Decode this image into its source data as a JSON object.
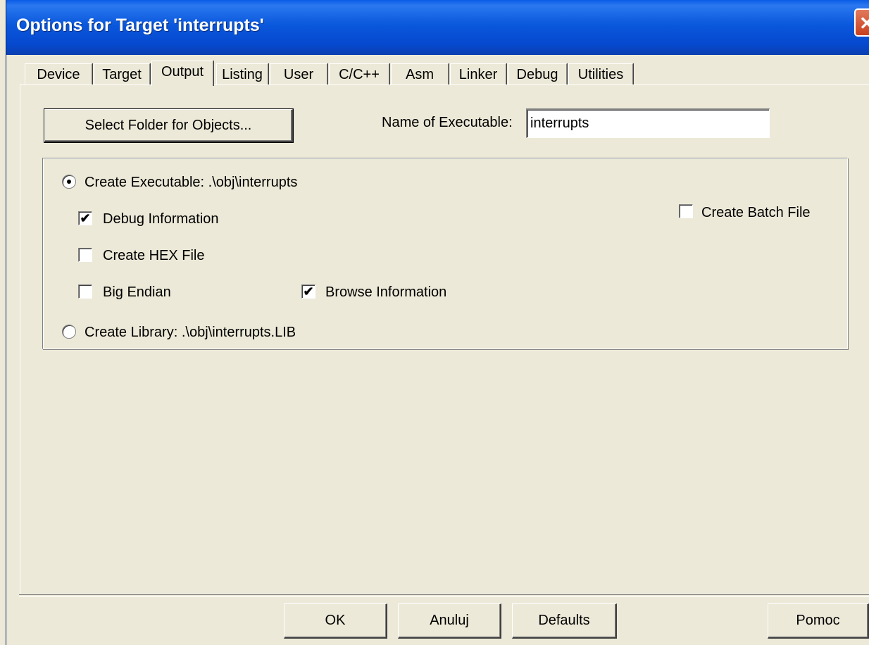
{
  "window": {
    "title": "Options for Target 'interrupts'",
    "close_glyph": "✕"
  },
  "tabs": [
    {
      "label": "Device"
    },
    {
      "label": "Target"
    },
    {
      "label": "Output"
    },
    {
      "label": "Listing"
    },
    {
      "label": "User"
    },
    {
      "label": "C/C++"
    },
    {
      "label": "Asm"
    },
    {
      "label": "Linker"
    },
    {
      "label": "Debug"
    },
    {
      "label": "Utilities"
    }
  ],
  "active_tab": "Output",
  "output": {
    "select_folder_label": "Select Folder for Objects...",
    "name_of_executable_label": "Name of Executable:",
    "name_of_executable_value": "interrupts",
    "create_executable_label": "Create Executable:  .\\obj\\interrupts",
    "create_executable_selected": true,
    "debug_information_label": "Debug Information",
    "debug_information_checked": true,
    "create_hex_label": "Create HEX File",
    "create_hex_checked": false,
    "big_endian_label": "Big Endian",
    "big_endian_checked": false,
    "browse_information_label": "Browse Information",
    "browse_information_checked": true,
    "create_batch_label": "Create Batch File",
    "create_batch_checked": false,
    "create_library_label": "Create Library:  .\\obj\\interrupts.LIB",
    "create_library_selected": false,
    "check_glyph": "✔"
  },
  "footer": {
    "ok_label": "OK",
    "cancel_label": "Anuluj",
    "defaults_label": "Defaults",
    "help_label": "Pomoc"
  }
}
